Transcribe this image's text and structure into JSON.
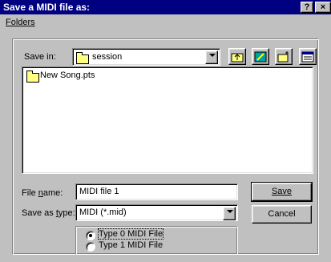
{
  "window": {
    "title": "Save a MIDI file as:",
    "help_button": "?",
    "close_button": "×"
  },
  "menu": {
    "folders": "Folders"
  },
  "location": {
    "save_in_label": "Save in:",
    "current_folder": "session"
  },
  "file_list": {
    "items": [
      {
        "name": "New Song.pts",
        "icon": "folder-icon"
      }
    ]
  },
  "form": {
    "file_name_label": "File name:",
    "file_name_value": "MIDI file 1",
    "save_as_type_label": "Save as type:",
    "save_as_type_value": "MIDI (*.mid)"
  },
  "buttons": {
    "save": "Save",
    "cancel": "Cancel"
  },
  "midi_type": {
    "options": [
      "Type 0 MIDI File",
      "Type 1 MIDI File"
    ],
    "selected_index": 0
  },
  "colors": {
    "titlebar": "#000080",
    "face": "#c0c0c0",
    "folder": "#ffff80"
  }
}
